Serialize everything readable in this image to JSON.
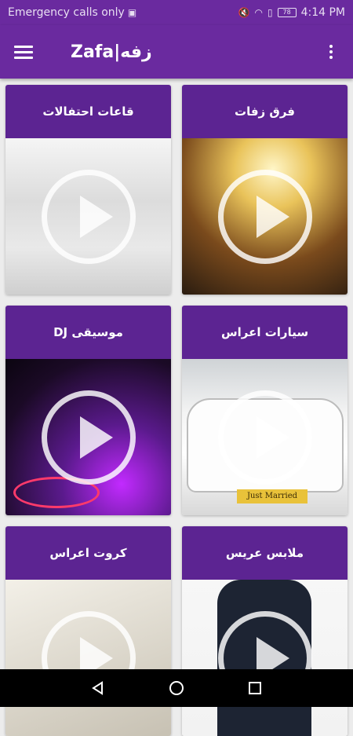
{
  "status_bar": {
    "carrier_text": "Emergency calls only",
    "battery_level": "78",
    "time": "4:14 PM"
  },
  "app_bar": {
    "title": "Zafa|زفه"
  },
  "cards": [
    {
      "title": "قاعات احتفالات",
      "media": "wedding-hall-image"
    },
    {
      "title": "فرق زفات",
      "media": "wedding-band-image"
    },
    {
      "title": "موسيقى DJ",
      "media": "dj-turntable-image"
    },
    {
      "title": "سيارات اعراس",
      "media": "wedding-car-image"
    },
    {
      "title": "كروت اعراس",
      "media": "wedding-card-image"
    },
    {
      "title": "ملابس عريس",
      "media": "groom-suit-image"
    }
  ],
  "car_plate_text": "Just Married",
  "colors": {
    "primary": "#6a2a9f",
    "card_header": "#5c2492",
    "nav_bar": "#000000"
  }
}
